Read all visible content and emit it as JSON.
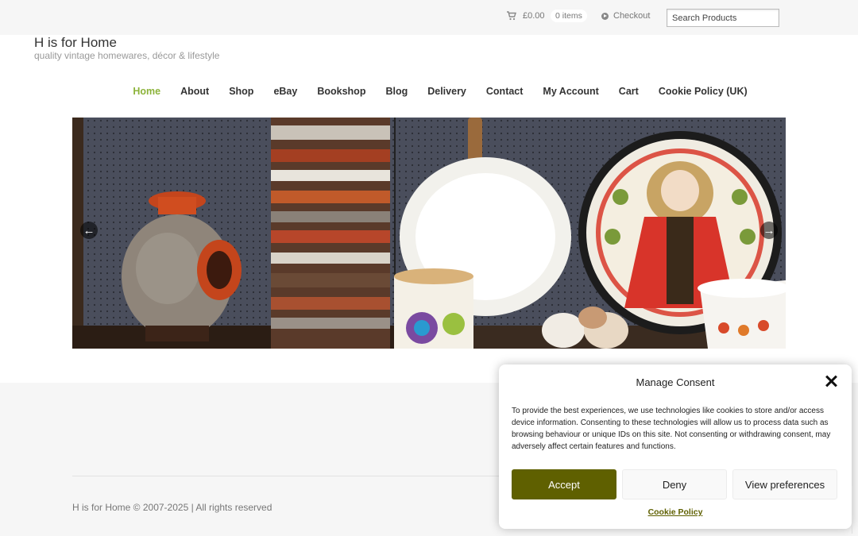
{
  "topbar": {
    "cart_amount": "£0.00",
    "cart_items": "0 items",
    "checkout_label": "Checkout",
    "search_placeholder": "Search Products",
    "cart_icon": "shopping-cart-icon",
    "checkout_icon": "arrow-circle-icon"
  },
  "header": {
    "site_title": "H is for Home",
    "tagline": "quality vintage homewares, décor & lifestyle"
  },
  "nav": {
    "items": [
      {
        "label": "Home",
        "active": true
      },
      {
        "label": "About"
      },
      {
        "label": "Shop"
      },
      {
        "label": "eBay"
      },
      {
        "label": "Bookshop"
      },
      {
        "label": "Blog"
      },
      {
        "label": "Delivery"
      },
      {
        "label": "Contact"
      },
      {
        "label": "My Account"
      },
      {
        "label": "Cart"
      },
      {
        "label": "Cookie Policy (UK)"
      }
    ]
  },
  "slider": {
    "prev_icon": "arrow-left-icon",
    "next_icon": "arrow-right-icon"
  },
  "footer": {
    "copyright": "H is for Home © 2007-2025 | All rights reserved"
  },
  "consent": {
    "title": "Manage Consent",
    "body": "To provide the best experiences, we use technologies like cookies to store and/or access device information. Consenting to these technologies will allow us to process data such as browsing behaviour or unique IDs on this site. Not consenting or withdrawing consent, may adversely affect certain features and functions.",
    "accept_label": "Accept",
    "deny_label": "Deny",
    "preferences_label": "View preferences",
    "policy_link": "Cookie Policy",
    "accent_color": "#5f6000"
  },
  "colors": {
    "nav_active": "#8cb33a"
  }
}
